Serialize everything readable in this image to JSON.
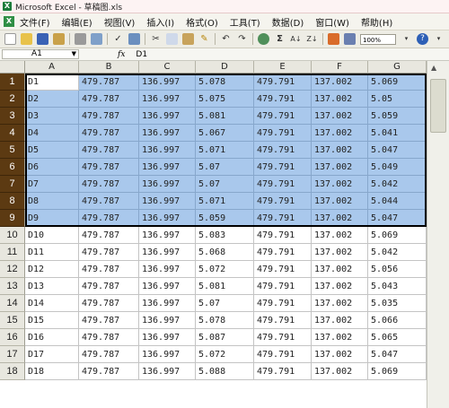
{
  "window": {
    "title": "Microsoft Excel - 草稿图.xls"
  },
  "menus": [
    "文件(F)",
    "编辑(E)",
    "视图(V)",
    "插入(I)",
    "格式(O)",
    "工具(T)",
    "数据(D)",
    "窗口(W)",
    "帮助(H)"
  ],
  "toolbar": {
    "zoom": "100%",
    "icons": [
      "new-icon",
      "open-icon",
      "save-icon",
      "permission-icon",
      "print-icon",
      "print-preview-icon",
      "spelling-icon",
      "research-icon",
      "cut-icon",
      "copy-icon",
      "paste-icon",
      "format-painter-icon",
      "undo-icon",
      "redo-icon",
      "hyperlink-icon",
      "autosum-icon",
      "sort-ascending-icon",
      "sort-descending-icon",
      "chart-wizard-icon",
      "drawing-icon",
      "help-icon"
    ]
  },
  "formula_bar": {
    "name_box": "A1",
    "fx": "fx",
    "content": "D1"
  },
  "columns": [
    "A",
    "B",
    "C",
    "D",
    "E",
    "F",
    "G"
  ],
  "rows": [
    {
      "n": "1",
      "cells": [
        "D1",
        "479.787",
        "136.997",
        "5.078",
        "479.791",
        "137.002",
        "5.069"
      ]
    },
    {
      "n": "2",
      "cells": [
        "D2",
        "479.787",
        "136.997",
        "5.075",
        "479.791",
        "137.002",
        "5.05"
      ]
    },
    {
      "n": "3",
      "cells": [
        "D3",
        "479.787",
        "136.997",
        "5.081",
        "479.791",
        "137.002",
        "5.059"
      ]
    },
    {
      "n": "4",
      "cells": [
        "D4",
        "479.787",
        "136.997",
        "5.067",
        "479.791",
        "137.002",
        "5.041"
      ]
    },
    {
      "n": "5",
      "cells": [
        "D5",
        "479.787",
        "136.997",
        "5.071",
        "479.791",
        "137.002",
        "5.047"
      ]
    },
    {
      "n": "6",
      "cells": [
        "D6",
        "479.787",
        "136.997",
        "5.07",
        "479.791",
        "137.002",
        "5.049"
      ]
    },
    {
      "n": "7",
      "cells": [
        "D7",
        "479.787",
        "136.997",
        "5.07",
        "479.791",
        "137.002",
        "5.042"
      ]
    },
    {
      "n": "8",
      "cells": [
        "D8",
        "479.787",
        "136.997",
        "5.071",
        "479.791",
        "137.002",
        "5.044"
      ]
    },
    {
      "n": "9",
      "cells": [
        "D9",
        "479.787",
        "136.997",
        "5.059",
        "479.791",
        "137.002",
        "5.047"
      ]
    },
    {
      "n": "10",
      "cells": [
        "D10",
        "479.787",
        "136.997",
        "5.083",
        "479.791",
        "137.002",
        "5.069"
      ]
    },
    {
      "n": "11",
      "cells": [
        "D11",
        "479.787",
        "136.997",
        "5.068",
        "479.791",
        "137.002",
        "5.042"
      ]
    },
    {
      "n": "12",
      "cells": [
        "D12",
        "479.787",
        "136.997",
        "5.072",
        "479.791",
        "137.002",
        "5.056"
      ]
    },
    {
      "n": "13",
      "cells": [
        "D13",
        "479.787",
        "136.997",
        "5.081",
        "479.791",
        "137.002",
        "5.043"
      ]
    },
    {
      "n": "14",
      "cells": [
        "D14",
        "479.787",
        "136.997",
        "5.07",
        "479.791",
        "137.002",
        "5.035"
      ]
    },
    {
      "n": "15",
      "cells": [
        "D15",
        "479.787",
        "136.997",
        "5.078",
        "479.791",
        "137.002",
        "5.066"
      ]
    },
    {
      "n": "16",
      "cells": [
        "D16",
        "479.787",
        "136.997",
        "5.087",
        "479.791",
        "137.002",
        "5.065"
      ]
    },
    {
      "n": "17",
      "cells": [
        "D17",
        "479.787",
        "136.997",
        "5.072",
        "479.791",
        "137.002",
        "5.047"
      ]
    },
    {
      "n": "18",
      "cells": [
        "D18",
        "479.787",
        "136.997",
        "5.088",
        "479.791",
        "137.002",
        "5.069"
      ]
    }
  ],
  "selected_rows": 9
}
